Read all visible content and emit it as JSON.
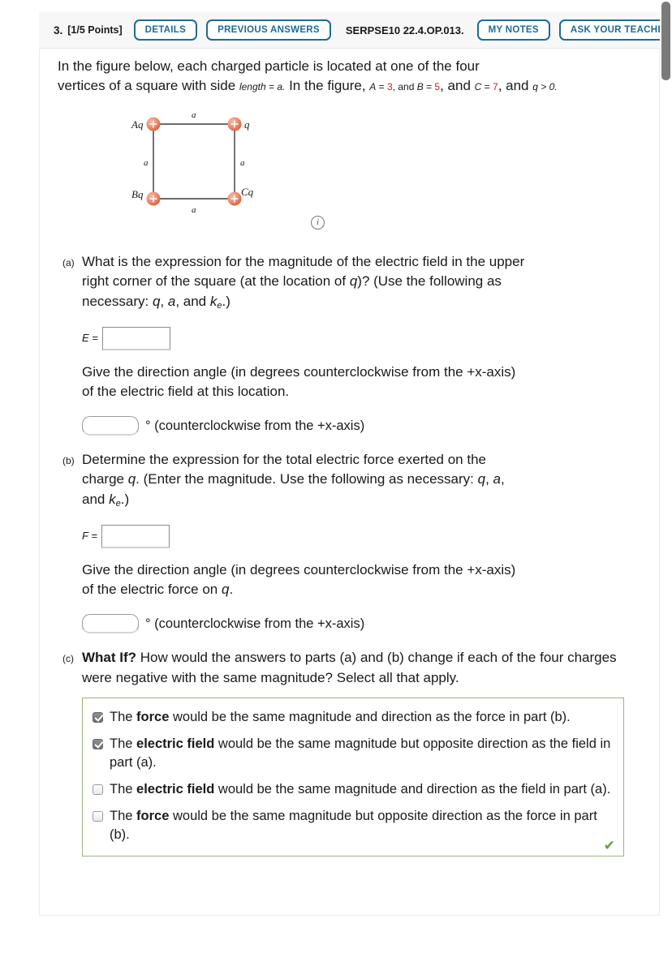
{
  "header": {
    "number": "3.",
    "points": "[1/5 Points]",
    "details_label": "DETAILS",
    "previous_answers_label": "PREVIOUS ANSWERS",
    "question_code": "SERPSE10 22.4.OP.013.",
    "my_notes_label": "MY NOTES",
    "ask_teacher_label": "ASK YOUR TEACHER"
  },
  "stem": {
    "line1": "In the figure below, each charged particle is located at one of the four",
    "line2a": "vertices of a square with side ",
    "line2b": "length = a.",
    "line2c": " In the figure, ",
    "a_var": "A",
    "a_eq": " = ",
    "a_val": "3",
    "b_var": "B",
    "b_val": "5",
    "and1": ", and ",
    "c_var": "C",
    "c_val": "7",
    "and2": ", and ",
    "q_cond": "q > 0."
  },
  "figure": {
    "top_left_label": "Aq",
    "top_right_label": "q",
    "bottom_left_label": "Bq",
    "bottom_right_label": "Cq",
    "side_top": "a",
    "side_left": "a",
    "side_right": "a",
    "side_bottom": "a",
    "charge_sign": "+",
    "info_icon": "i",
    "charge_color": "#e8836a",
    "line_color": "#3a3a3a"
  },
  "parts": {
    "a": {
      "label": "(a)",
      "q_line1": "What is the expression for the magnitude of the electric field in the upper",
      "q_line2a": "right corner of the square (at the location of ",
      "q_line2_var": "q",
      "q_line2b": ")? (Use the following as",
      "q_line3a": "necessary: ",
      "q_line3_v1": "q",
      "q_line3_sep1": ", ",
      "q_line3_v2": "a",
      "q_line3_sep2": ", and ",
      "q_line3_v3": "k",
      "q_line3_sub": "e",
      "q_line3_end": ".)",
      "answer_label": "E =",
      "answer_value": "",
      "dir_line1": "Give the direction angle (in degrees counterclockwise from the +x-axis)",
      "dir_line2": "of the electric field at this location.",
      "angle_value": "",
      "angle_suffix": "° (counterclockwise from the +x-axis)"
    },
    "b": {
      "label": "(b)",
      "q_line1": "Determine the expression for the total electric force exerted on the",
      "q_line2a": "charge ",
      "q_line2_var": "q",
      "q_line2b": ". (Enter the magnitude. Use the following as necessary: ",
      "q_line2_v1": "q",
      "q_line2_sep": ", ",
      "q_line2_v2": "a",
      "q_line3a": "and ",
      "q_line3_v3": "k",
      "q_line3_sub": "e",
      "q_line3_end": ".)",
      "answer_label": "F =",
      "answer_value": "",
      "dir_line1": "Give the direction angle (in degrees counterclockwise from the +x-axis)",
      "dir_line2a": "of the electric force on ",
      "dir_line2_var": "q",
      "dir_line2b": ".",
      "angle_value": "",
      "angle_suffix": "° (counterclockwise from the +x-axis)"
    },
    "c": {
      "label": "(c)",
      "what_if": "What If?",
      "q_rest": " How would the answers to parts (a) and (b) change if each of the four charges were negative with the same magnitude? Select all that apply.",
      "choices": [
        {
          "checked": true,
          "pre": "The ",
          "bold": "force",
          "post": " would be the same magnitude and direction as the force in part (b)."
        },
        {
          "checked": true,
          "pre": "The ",
          "bold": "electric field",
          "post": " would be the same magnitude but opposite direction as the field in part (a)."
        },
        {
          "checked": false,
          "pre": "The ",
          "bold": "electric field",
          "post": " would be the same magnitude and direction as the field in part (a)."
        },
        {
          "checked": false,
          "pre": "The ",
          "bold": "force",
          "post": " would be the same magnitude but opposite direction as the force in part (b)."
        }
      ],
      "correct_mark": "✔",
      "correct_mark_color": "#5f9e4f",
      "box_border_color": "#9db37c"
    }
  },
  "colors": {
    "button_blue": "#1f6a95",
    "red_value": "#cc2222",
    "header_bg": "#f7f7f7"
  }
}
